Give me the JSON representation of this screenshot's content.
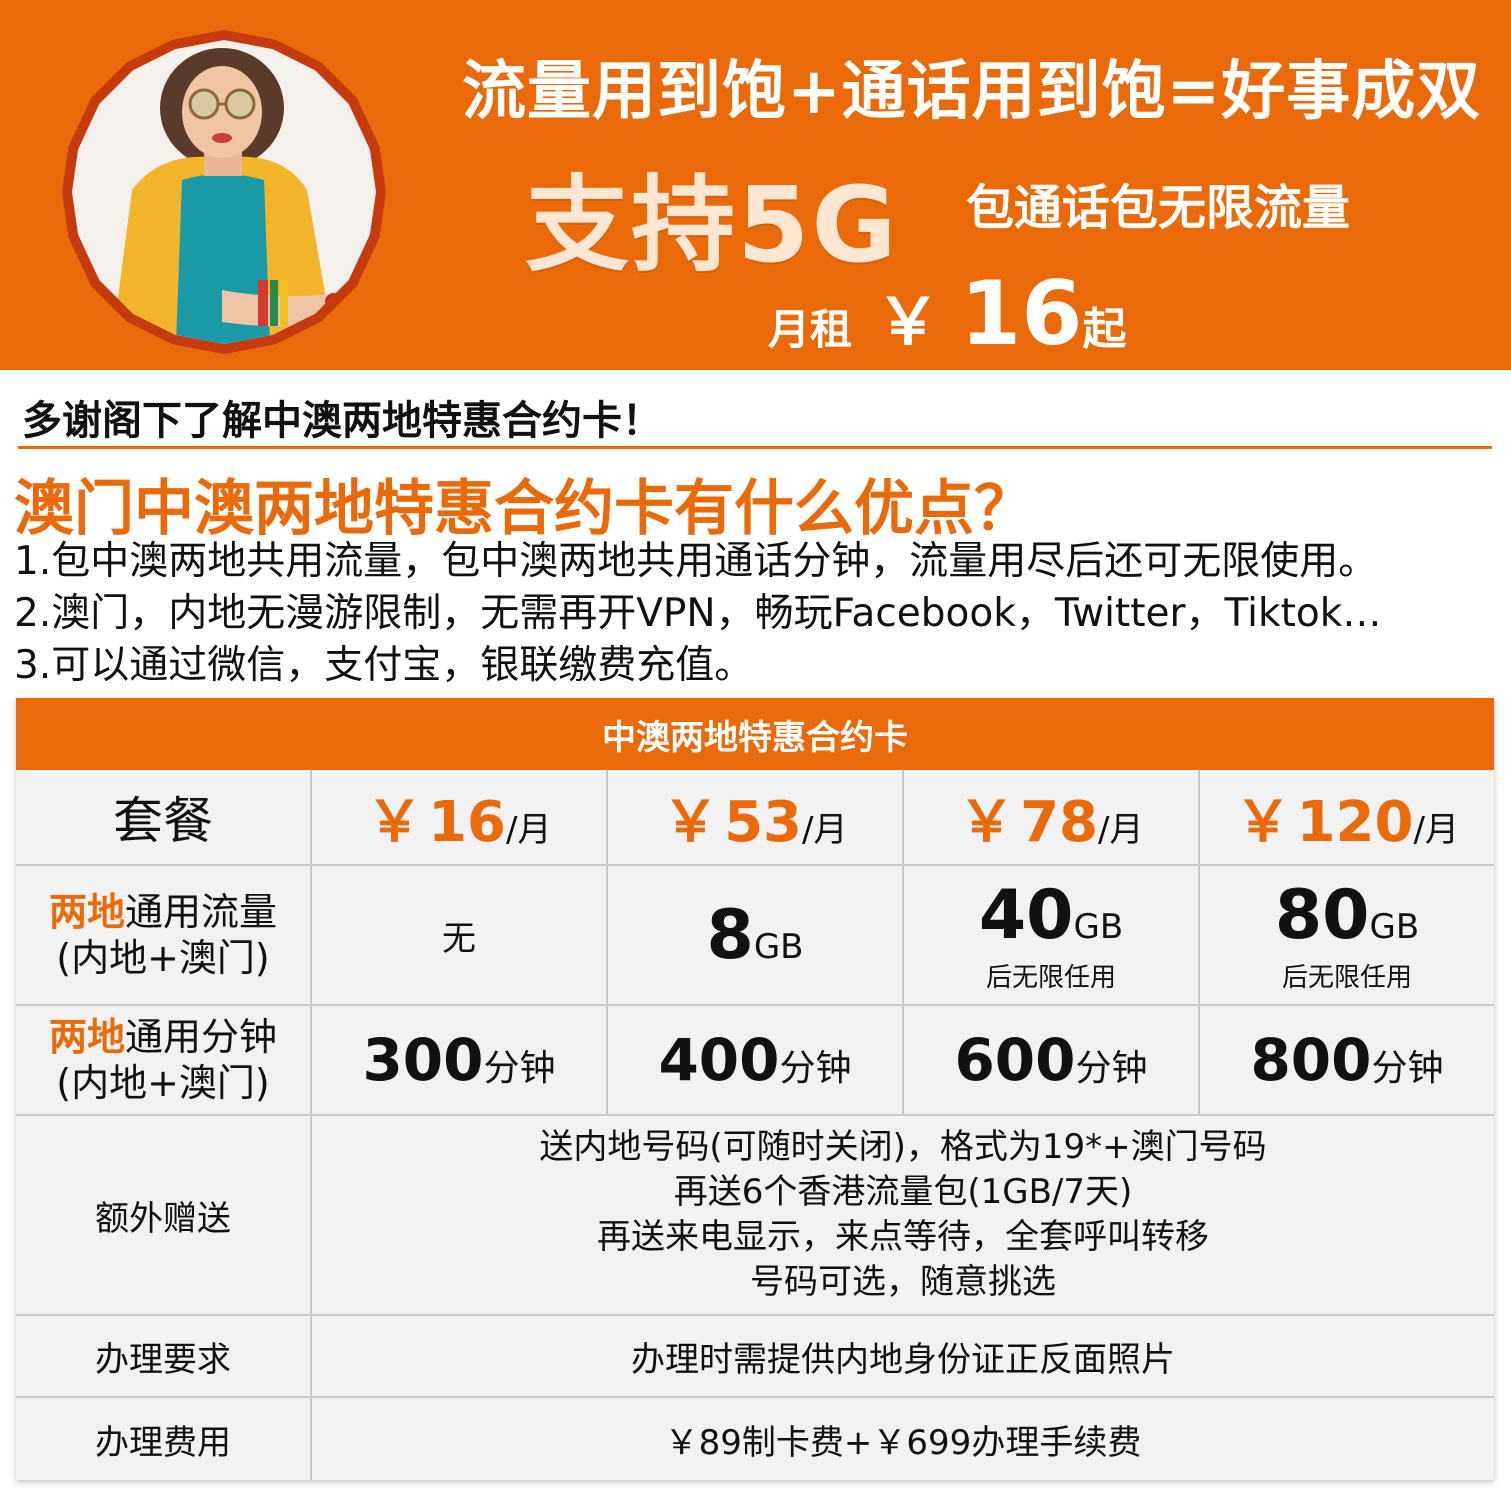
{
  "banner": {
    "headline": "流量用到饱+通话用到饱=好事成双",
    "support_5g": "支持5G",
    "sub_tag": "包通话包无限流量",
    "rent_label": "月租",
    "currency": "￥",
    "price": "16",
    "price_suffix": "起",
    "bg_color": "#ea6a0a"
  },
  "intro": {
    "thanks": "多谢阁下了解中澳两地特惠合约卡！",
    "question": "澳门中澳两地特惠合约卡有什么优点？",
    "points": [
      "1.包中澳两地共用流量，包中澳两地共用通话分钟，流量用尽后还可无限使用。",
      "2.澳门，内地无漫游限制，无需再开VPN，畅玩Facebook，Twitter，Tiktok…",
      "3.可以通过微信，支付宝，银联缴费充值。"
    ]
  },
  "table": {
    "title": "中澳两地特惠合约卡",
    "plan_label": "套餐",
    "plans": [
      {
        "currency": "￥",
        "price": "16",
        "unit": "/月"
      },
      {
        "currency": "￥",
        "price": "53",
        "unit": "/月"
      },
      {
        "currency": "￥",
        "price": "78",
        "unit": "/月"
      },
      {
        "currency": "￥",
        "price": "120",
        "unit": "/月"
      }
    ],
    "data_row": {
      "label_hl": "两地",
      "label_rest": "通用流量",
      "label_sub": "(内地+澳门)",
      "values": [
        {
          "value": "无",
          "unit": "",
          "note": ""
        },
        {
          "value": "8",
          "unit": "GB",
          "note": ""
        },
        {
          "value": "40",
          "unit": "GB",
          "note": "后无限任用"
        },
        {
          "value": "80",
          "unit": "GB",
          "note": "后无限任用"
        }
      ]
    },
    "minutes_row": {
      "label_hl": "两地",
      "label_rest": "通用分钟",
      "label_sub": "(内地+澳门)",
      "values": [
        {
          "value": "300",
          "unit": "分钟"
        },
        {
          "value": "400",
          "unit": "分钟"
        },
        {
          "value": "600",
          "unit": "分钟"
        },
        {
          "value": "800",
          "unit": "分钟"
        }
      ]
    },
    "gift_row": {
      "label": "额外赠送",
      "lines": [
        "送内地号码(可随时关闭)，格式为19*+澳门号码",
        "再送6个香港流量包(1GB/7天)",
        "再送来电显示，来点等待，全套呼叫转移",
        "号码可选，随意挑选"
      ]
    },
    "requirement_row": {
      "label": "办理要求",
      "value": "办理时需提供内地身份证正反面照片"
    },
    "fee_row": {
      "label": "办理费用",
      "value": "￥89制卡费+￥699办理手续费"
    }
  }
}
